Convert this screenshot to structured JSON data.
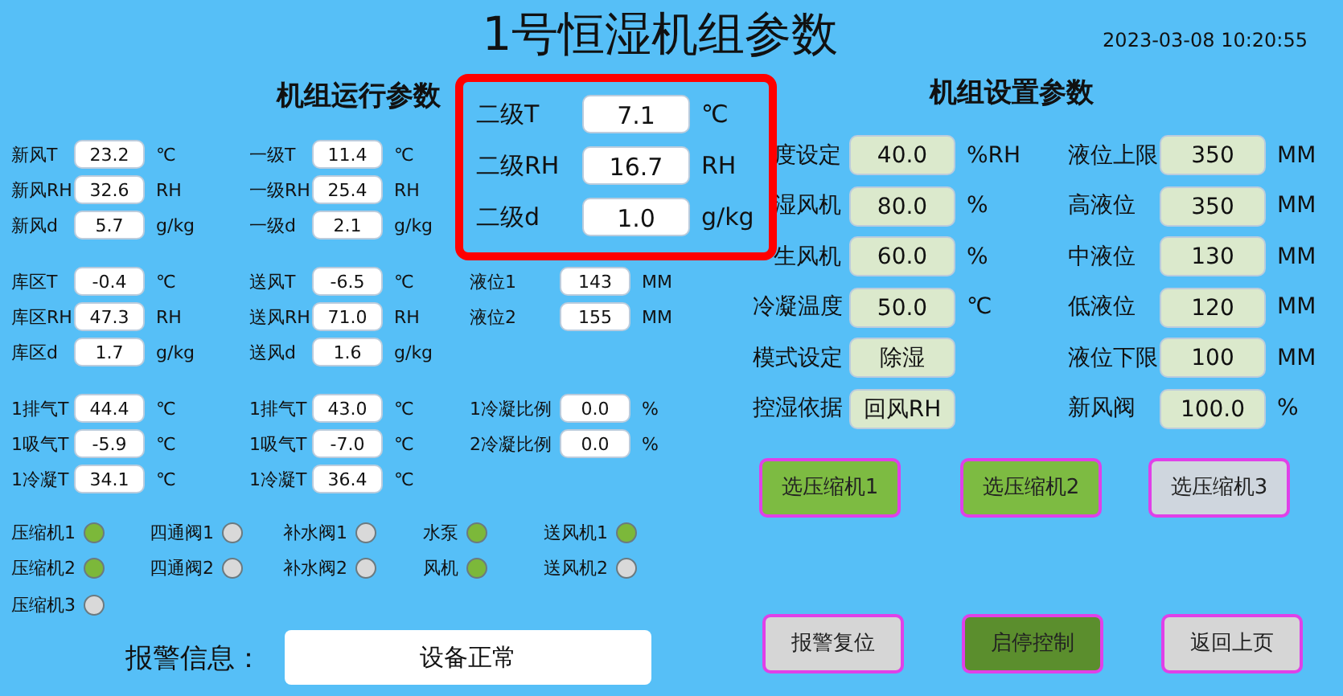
{
  "title": "1号恒湿机组参数",
  "datetime": "2023-03-08 10:20:55",
  "run_params": {
    "heading": "机组运行参数",
    "groups": [
      [
        [
          {
            "label": "新风T",
            "value": "23.2",
            "unit": "℃"
          },
          {
            "label": "一级T",
            "value": "11.4",
            "unit": "℃"
          }
        ],
        [
          {
            "label": "新风RH",
            "value": "32.6",
            "unit": "RH"
          },
          {
            "label": "一级RH",
            "value": "25.4",
            "unit": "RH"
          }
        ],
        [
          {
            "label": "新风d",
            "value": "5.7",
            "unit": "g/kg"
          },
          {
            "label": "一级d",
            "value": "2.1",
            "unit": "g/kg"
          }
        ]
      ],
      [
        [
          {
            "label": "库区T",
            "value": "-0.4",
            "unit": "℃"
          },
          {
            "label": "送风T",
            "value": "-6.5",
            "unit": "℃"
          },
          {
            "label": "液位1",
            "value": "143",
            "unit": "MM"
          }
        ],
        [
          {
            "label": "库区RH",
            "value": "47.3",
            "unit": "RH"
          },
          {
            "label": "送风RH",
            "value": "71.0",
            "unit": "RH"
          },
          {
            "label": "液位2",
            "value": "155",
            "unit": "MM"
          }
        ],
        [
          {
            "label": "库区d",
            "value": "1.7",
            "unit": "g/kg"
          },
          {
            "label": "送风d",
            "value": "1.6",
            "unit": "g/kg"
          }
        ]
      ],
      [
        [
          {
            "label": "1排气T",
            "value": "44.4",
            "unit": "℃"
          },
          {
            "label": "1排气T",
            "value": "43.0",
            "unit": "℃"
          },
          {
            "label": "1冷凝比例",
            "value": "0.0",
            "unit": "%"
          }
        ],
        [
          {
            "label": "1吸气T",
            "value": "-5.9",
            "unit": "℃"
          },
          {
            "label": "1吸气T",
            "value": "-7.0",
            "unit": "℃"
          },
          {
            "label": "2冷凝比例",
            "value": "0.0",
            "unit": "%"
          }
        ],
        [
          {
            "label": "1冷凝T",
            "value": "34.1",
            "unit": "℃"
          },
          {
            "label": "1冷凝T",
            "value": "36.4",
            "unit": "℃"
          }
        ]
      ]
    ]
  },
  "stage2": [
    {
      "label": "二级T",
      "value": "7.1",
      "unit": "℃"
    },
    {
      "label": "二级RH",
      "value": "16.7",
      "unit": "RH"
    },
    {
      "label": "二级d",
      "value": "1.0",
      "unit": "g/kg"
    }
  ],
  "lamps": [
    [
      {
        "label": "压缩机1",
        "on": true
      },
      {
        "label": "压缩机2",
        "on": true
      },
      {
        "label": "压缩机3",
        "on": false
      }
    ],
    [
      {
        "label": "四通阀1",
        "on": false
      },
      {
        "label": "四通阀2",
        "on": false
      }
    ],
    [
      {
        "label": "补水阀1",
        "on": false
      },
      {
        "label": "补水阀2",
        "on": false
      }
    ],
    [
      {
        "label": "水泵",
        "on": true
      },
      {
        "label": "风机",
        "on": true
      }
    ],
    [
      {
        "label": "送风机1",
        "on": true
      },
      {
        "label": "送风机2",
        "on": false
      }
    ]
  ],
  "alarm": {
    "label": "报警信息：",
    "value": "设备正常"
  },
  "settings": {
    "heading": "机组设置参数",
    "columns": [
      [
        {
          "label": "度设定",
          "value": "40.0",
          "unit": "%RH"
        },
        {
          "label": "湿风机",
          "value": "80.0",
          "unit": "%"
        },
        {
          "label": "生风机",
          "value": "60.0",
          "unit": "%"
        },
        {
          "label": "冷凝温度",
          "value": "50.0",
          "unit": "℃"
        },
        {
          "label": "模式设定",
          "value": "除湿"
        },
        {
          "label": "控湿依据",
          "value": "回风RH"
        }
      ],
      [
        {
          "label": "液位上限",
          "value": "350",
          "unit": "MM"
        },
        {
          "label": "高液位",
          "value": "350",
          "unit": "MM"
        },
        {
          "label": "中液位",
          "value": "130",
          "unit": "MM"
        },
        {
          "label": "低液位",
          "value": "120",
          "unit": "MM"
        },
        {
          "label": "液位下限",
          "value": "100",
          "unit": "MM"
        },
        {
          "label": "新风阀",
          "value": "100.0",
          "unit": "%"
        }
      ]
    ]
  },
  "compressor_buttons": [
    {
      "label": "选压缩机1",
      "selected": true
    },
    {
      "label": "选压缩机2",
      "selected": true
    },
    {
      "label": "选压缩机3",
      "selected": false
    }
  ],
  "actions": [
    {
      "label": "报警复位",
      "selected": false
    },
    {
      "label": "启停控制",
      "selected": true
    },
    {
      "label": "返回上页",
      "selected": false
    }
  ]
}
